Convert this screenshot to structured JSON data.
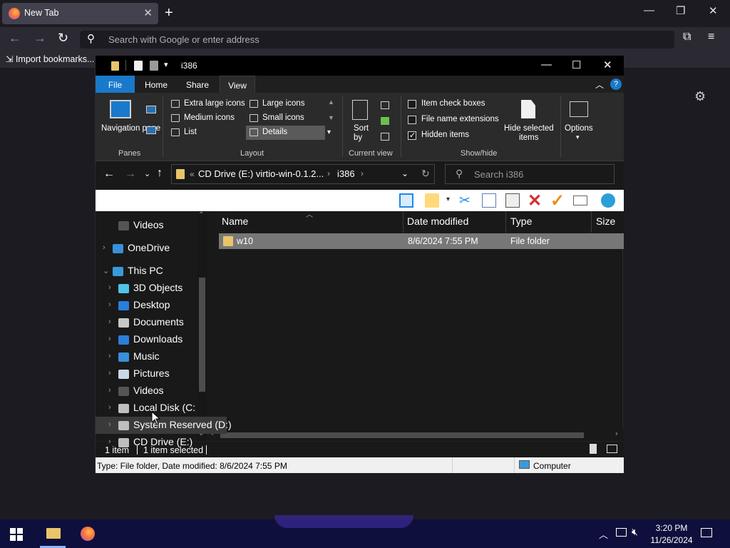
{
  "browser": {
    "tab_title": "New Tab",
    "search_placeholder": "Search with Google or enter address",
    "bookmark_import": "Import bookmarks..."
  },
  "explorer": {
    "title": "i386",
    "tabs": [
      "File",
      "Home",
      "Share",
      "View"
    ],
    "ribbon": {
      "nav_pane": "Navigation pane",
      "layout_items": [
        "Extra large icons",
        "Large icons",
        "Medium icons",
        "Small icons",
        "List",
        "Details"
      ],
      "sort_label_1": "Sort",
      "sort_label_2": "by",
      "checks": [
        {
          "label": "Item check boxes",
          "checked": false
        },
        {
          "label": "File name extensions",
          "checked": false
        },
        {
          "label": "Hidden items",
          "checked": true
        }
      ],
      "hide_selected_1": "Hide selected",
      "hide_selected_2": "items",
      "options": "Options",
      "groups": [
        "Panes",
        "Layout",
        "Current view",
        "Show/hide"
      ]
    },
    "address": {
      "prefix": "«",
      "path_1": "CD Drive (E:) virtio-win-0.1.2...",
      "path_2": "i386",
      "search_placeholder": "Search i386"
    },
    "nav": [
      {
        "label": "Videos",
        "icon": "videos-icon"
      },
      {
        "label": "OneDrive",
        "icon": "onedrive-icon"
      },
      {
        "label": "This PC",
        "icon": "computer-icon"
      },
      {
        "label": "3D Objects",
        "icon": "3d-objects-icon"
      },
      {
        "label": "Desktop",
        "icon": "desktop-icon"
      },
      {
        "label": "Documents",
        "icon": "documents-icon"
      },
      {
        "label": "Downloads",
        "icon": "downloads-icon"
      },
      {
        "label": "Music",
        "icon": "music-icon"
      },
      {
        "label": "Pictures",
        "icon": "pictures-icon"
      },
      {
        "label": "Videos",
        "icon": "videos-icon"
      },
      {
        "label": "Local Disk (C:)",
        "icon": "drive-icon"
      },
      {
        "label": "System Reserved (D:)",
        "icon": "drive-icon"
      },
      {
        "label": "CD Drive (E:) vi",
        "icon": "cd-drive-icon"
      }
    ],
    "columns": [
      "Name",
      "Date modified",
      "Type",
      "Size"
    ],
    "rows": [
      {
        "name": "w10",
        "date": "8/6/2024 7:55 PM",
        "type": "File folder",
        "size": ""
      }
    ],
    "status": {
      "count": "1 item",
      "selected": "1 item selected"
    },
    "details": {
      "text": "Type: File folder, Date modified: 8/6/2024 7:55 PM",
      "location": "Computer"
    }
  },
  "taskbar": {
    "time": "3:20 PM",
    "date": "11/26/2024"
  }
}
